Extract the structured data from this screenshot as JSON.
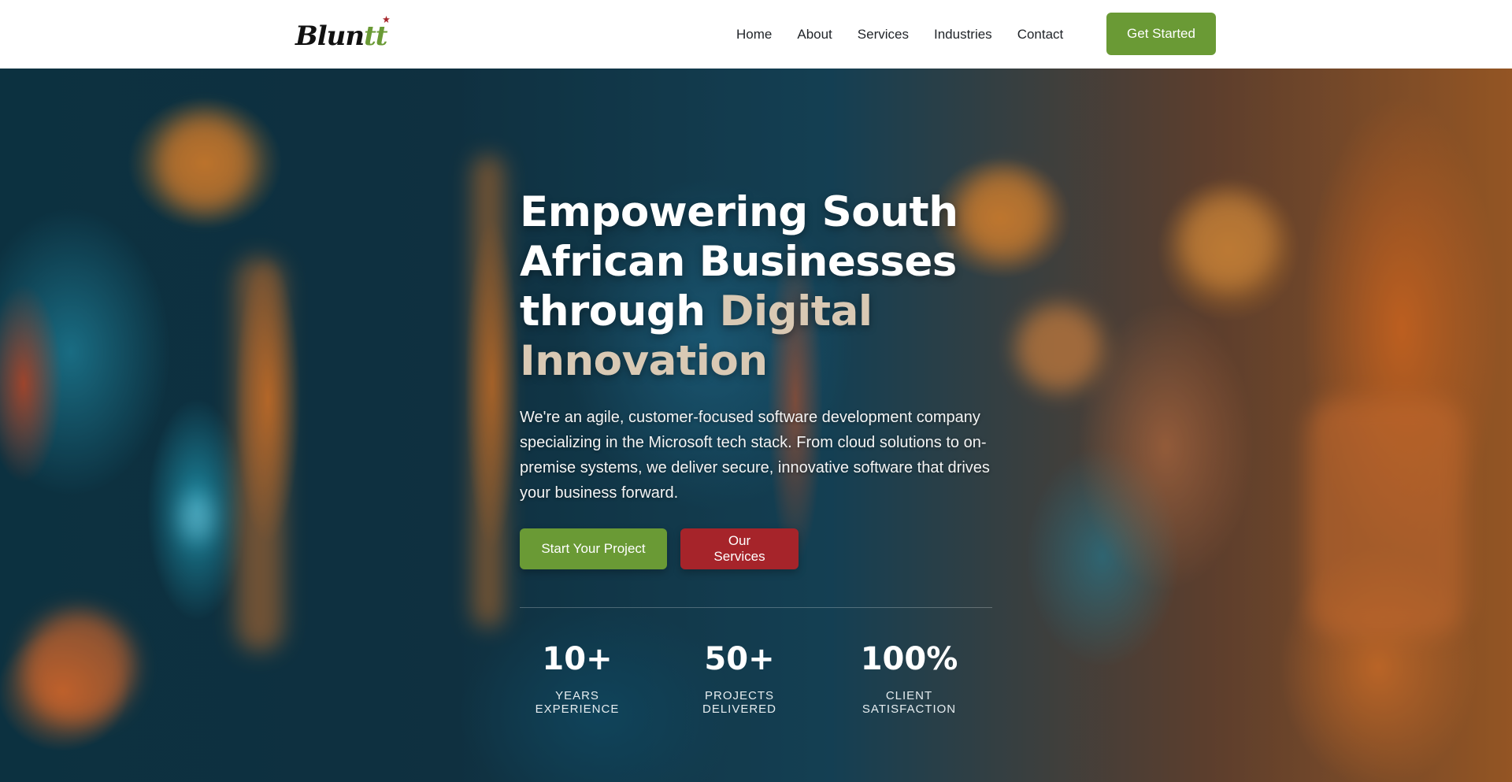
{
  "header": {
    "logo_text_main": "Blun",
    "logo_text_last": "tt",
    "nav": [
      "Home",
      "About",
      "Services",
      "Industries",
      "Contact"
    ],
    "cta_label": "Get Started"
  },
  "hero": {
    "title_line1": "Empowering South",
    "title_line2": "African Businesses",
    "title_line3_plain": "through ",
    "title_line3_accent": "Digital",
    "title_line4_accent": "Innovation",
    "subtitle": "We're an agile, customer-focused software development company specializing in the Microsoft tech stack. From cloud solutions to on-premise systems, we deliver secure, innovative software that drives your business forward.",
    "primary_button": "Start Your Project",
    "secondary_button": "Our Services",
    "stats": [
      {
        "value": "10+",
        "label": "YEARS EXPERIENCE"
      },
      {
        "value": "50+",
        "label": "PROJECTS DELIVERED"
      },
      {
        "value": "100%",
        "label": "CLIENT SATISFACTION"
      }
    ]
  },
  "colors": {
    "brand_green": "#6a9a35",
    "brand_red": "#a6242a",
    "accent_text": "#d9c9b4"
  }
}
